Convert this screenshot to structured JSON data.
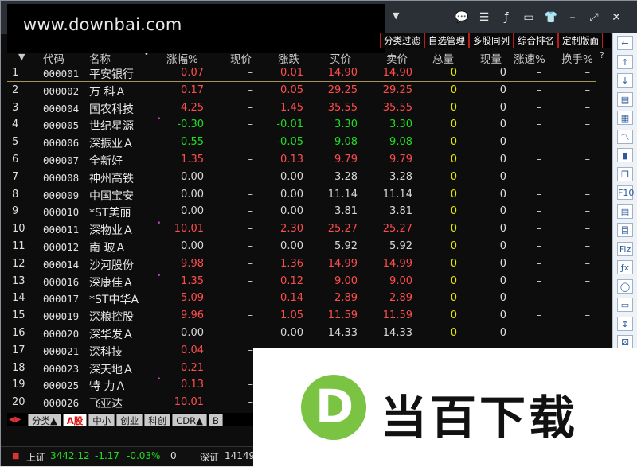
{
  "watermark": {
    "text": "www.downbai.com"
  },
  "title_bar": {
    "dropdown_icon": "chevron-down-icon",
    "buttons": [
      "chat-icon",
      "settings-sliders-icon",
      "formula-icon",
      "monitor-icon",
      "tshirt-skin-icon",
      "minimize-icon",
      "maximize-icon",
      "close-icon"
    ]
  },
  "sector_tabs": [
    "分类过滤",
    "自选管理",
    "多股同列",
    "综合排名",
    "定制版面"
  ],
  "table": {
    "headers": {
      "code": "代码",
      "name": "名称",
      "dot": "•",
      "pct": "涨幅%",
      "price": "现价",
      "change": "涨跌",
      "buy": "买价",
      "sell": "卖价",
      "volume": "总量",
      "cur_vol": "现量",
      "speed": "涨速%",
      "turnover": "换手%",
      "more": "?"
    },
    "rows": [
      {
        "idx": "1",
        "code": "000001",
        "name": "平安银行",
        "dot": "",
        "pct": "0.07",
        "price": "–",
        "chg": "0.01",
        "buy": "14.90",
        "sell": "14.90",
        "vol": "0",
        "cur": "0",
        "spd": "–",
        "turn": "–",
        "dir": "up"
      },
      {
        "idx": "2",
        "code": "000002",
        "name": "万 科Ａ",
        "dot": "",
        "pct": "0.17",
        "price": "–",
        "chg": "0.05",
        "buy": "29.25",
        "sell": "29.25",
        "vol": "0",
        "cur": "0",
        "spd": "–",
        "turn": "–",
        "dir": "up"
      },
      {
        "idx": "3",
        "code": "000004",
        "name": "国农科技",
        "dot": "",
        "pct": "4.25",
        "price": "–",
        "chg": "1.45",
        "buy": "35.55",
        "sell": "35.55",
        "vol": "0",
        "cur": "0",
        "spd": "–",
        "turn": "–",
        "dir": "up"
      },
      {
        "idx": "4",
        "code": "000005",
        "name": "世纪星源",
        "dot": "•",
        "pct": "-0.30",
        "price": "–",
        "chg": "-0.01",
        "buy": "3.30",
        "sell": "3.30",
        "vol": "0",
        "cur": "0",
        "spd": "–",
        "turn": "–",
        "dir": "down"
      },
      {
        "idx": "5",
        "code": "000006",
        "name": "深振业Ａ",
        "dot": "",
        "pct": "-0.55",
        "price": "–",
        "chg": "-0.05",
        "buy": "9.08",
        "sell": "9.08",
        "vol": "0",
        "cur": "0",
        "spd": "–",
        "turn": "–",
        "dir": "down"
      },
      {
        "idx": "6",
        "code": "000007",
        "name": "全新好",
        "dot": "",
        "pct": "1.35",
        "price": "–",
        "chg": "0.13",
        "buy": "9.79",
        "sell": "9.79",
        "vol": "0",
        "cur": "0",
        "spd": "–",
        "turn": "–",
        "dir": "up"
      },
      {
        "idx": "7",
        "code": "000008",
        "name": "神州高铁",
        "dot": "",
        "pct": "0.00",
        "price": "–",
        "chg": "0.00",
        "buy": "3.28",
        "sell": "3.28",
        "vol": "0",
        "cur": "0",
        "spd": "–",
        "turn": "–",
        "dir": "flat"
      },
      {
        "idx": "8",
        "code": "000009",
        "name": "中国宝安",
        "dot": "",
        "pct": "0.00",
        "price": "–",
        "chg": "0.00",
        "buy": "11.14",
        "sell": "11.14",
        "vol": "0",
        "cur": "0",
        "spd": "–",
        "turn": "–",
        "dir": "flat"
      },
      {
        "idx": "9",
        "code": "000010",
        "name": "*ST美丽",
        "dot": "",
        "pct": "0.00",
        "price": "–",
        "chg": "0.00",
        "buy": "3.81",
        "sell": "3.81",
        "vol": "0",
        "cur": "0",
        "spd": "–",
        "turn": "–",
        "dir": "flat"
      },
      {
        "idx": "10",
        "code": "000011",
        "name": "深物业Ａ",
        "dot": "•",
        "pct": "10.01",
        "price": "–",
        "chg": "2.30",
        "buy": "25.27",
        "sell": "25.27",
        "vol": "0",
        "cur": "0",
        "spd": "–",
        "turn": "–",
        "dir": "up"
      },
      {
        "idx": "11",
        "code": "000012",
        "name": "南 玻Ａ",
        "dot": "",
        "pct": "0.00",
        "price": "–",
        "chg": "0.00",
        "buy": "5.92",
        "sell": "5.92",
        "vol": "0",
        "cur": "0",
        "spd": "–",
        "turn": "–",
        "dir": "flat"
      },
      {
        "idx": "12",
        "code": "000014",
        "name": "沙河股份",
        "dot": "",
        "pct": "9.98",
        "price": "–",
        "chg": "1.36",
        "buy": "14.99",
        "sell": "14.99",
        "vol": "0",
        "cur": "0",
        "spd": "–",
        "turn": "–",
        "dir": "up"
      },
      {
        "idx": "13",
        "code": "000016",
        "name": "深康佳Ａ",
        "dot": "•",
        "pct": "1.35",
        "price": "–",
        "chg": "0.12",
        "buy": "9.00",
        "sell": "9.00",
        "vol": "0",
        "cur": "0",
        "spd": "–",
        "turn": "–",
        "dir": "up"
      },
      {
        "idx": "14",
        "code": "000017",
        "name": "*ST中华A",
        "dot": "",
        "pct": "5.09",
        "price": "–",
        "chg": "0.14",
        "buy": "2.89",
        "sell": "2.89",
        "vol": "0",
        "cur": "0",
        "spd": "–",
        "turn": "–",
        "dir": "up"
      },
      {
        "idx": "15",
        "code": "000019",
        "name": "深粮控股",
        "dot": "",
        "pct": "9.96",
        "price": "–",
        "chg": "1.05",
        "buy": "11.59",
        "sell": "11.59",
        "vol": "0",
        "cur": "0",
        "spd": "–",
        "turn": "–",
        "dir": "up"
      },
      {
        "idx": "16",
        "code": "000020",
        "name": "深华发Ａ",
        "dot": "",
        "pct": "0.00",
        "price": "–",
        "chg": "0.00",
        "buy": "14.33",
        "sell": "14.33",
        "vol": "0",
        "cur": "0",
        "spd": "–",
        "turn": "–",
        "dir": "flat"
      },
      {
        "idx": "17",
        "code": "000021",
        "name": "深科技",
        "dot": "",
        "pct": "0.04",
        "price": "–",
        "chg": "",
        "buy": "",
        "sell": "",
        "vol": "",
        "cur": "",
        "spd": "",
        "turn": "",
        "dir": "up"
      },
      {
        "idx": "18",
        "code": "000023",
        "name": "深天地Ａ",
        "dot": "",
        "pct": "0.21",
        "price": "–",
        "chg": "",
        "buy": "",
        "sell": "",
        "vol": "",
        "cur": "",
        "spd": "",
        "turn": "",
        "dir": "up"
      },
      {
        "idx": "19",
        "code": "000025",
        "name": "特 力Ａ",
        "dot": "•",
        "pct": "0.13",
        "price": "–",
        "chg": "",
        "buy": "",
        "sell": "",
        "vol": "",
        "cur": "",
        "spd": "",
        "turn": "",
        "dir": "up"
      },
      {
        "idx": "20",
        "code": "000026",
        "name": "飞亚达",
        "dot": "",
        "pct": "10.01",
        "price": "–",
        "chg": "",
        "buy": "",
        "sell": "",
        "vol": "",
        "cur": "",
        "spd": "",
        "turn": "",
        "dir": "up"
      }
    ]
  },
  "bottom_tabs": {
    "nav_arrows": "◀▶",
    "tabs": [
      "分类▲",
      "A股",
      "中小",
      "创业",
      "科创",
      "CDR▲",
      "B"
    ]
  },
  "status_bar": {
    "sh_label": "上证",
    "sh_value": "3442.12",
    "sh_change": "-1.17",
    "sh_pct": "-0.03%",
    "sh_vol": "0",
    "sz_label": "深证",
    "sz_value": "14149."
  },
  "ad": {
    "logo_letter": "D",
    "text": "当百下载"
  },
  "right_toolbar": {
    "icons": [
      "arrow-left-icon",
      "arrow-up-icon",
      "arrow-down-icon",
      "report-icon",
      "grid-icon",
      "line-chart-icon",
      "candlestick-icon",
      "window-icon",
      "f10-icon",
      "notepad-icon",
      "info-icon",
      "fiz-icon",
      "fx-icon",
      "circle-icon",
      "folder-icon",
      "sort-icon",
      "dice-icon"
    ],
    "labels": [
      "←",
      "↑",
      "↓",
      "▤",
      "▦",
      "〽",
      "▮",
      "❐",
      "F10",
      "▤",
      "目",
      "Fiz",
      "ƒx",
      "◯",
      "▭",
      "↕",
      "⚄"
    ]
  },
  "colors": {
    "up": "#ff4d4d",
    "down": "#22dd22",
    "volume": "#e8e800",
    "tab_border": "#b91d1d",
    "ad_logo": "#7bc443"
  }
}
